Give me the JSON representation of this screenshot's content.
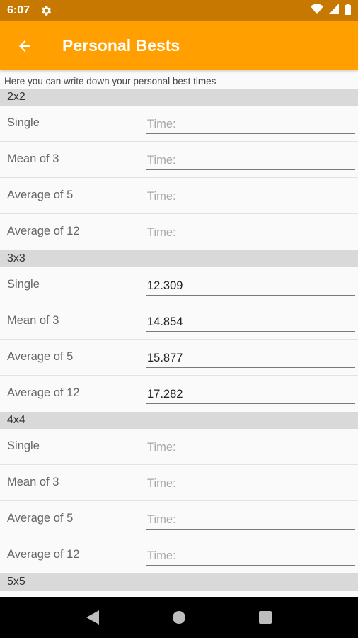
{
  "status_bar": {
    "time": "6:07"
  },
  "app_bar": {
    "title": "Personal Bests"
  },
  "hint": "Here you can write down your personal best times",
  "sections": [
    {
      "name": "2x2",
      "rows": [
        {
          "label": "Single",
          "value": "",
          "placeholder": "Time:"
        },
        {
          "label": "Mean of 3",
          "value": "",
          "placeholder": "Time:"
        },
        {
          "label": "Average of 5",
          "value": "",
          "placeholder": "Time:"
        },
        {
          "label": "Average of 12",
          "value": "",
          "placeholder": "Time:"
        }
      ]
    },
    {
      "name": "3x3",
      "rows": [
        {
          "label": "Single",
          "value": "12.309",
          "placeholder": "Time:"
        },
        {
          "label": "Mean of 3",
          "value": "14.854",
          "placeholder": "Time:"
        },
        {
          "label": "Average of 5",
          "value": "15.877",
          "placeholder": "Time:"
        },
        {
          "label": "Average of 12",
          "value": "17.282",
          "placeholder": "Time:"
        }
      ]
    },
    {
      "name": "4x4",
      "rows": [
        {
          "label": "Single",
          "value": "",
          "placeholder": "Time:"
        },
        {
          "label": "Mean of 3",
          "value": "",
          "placeholder": "Time:"
        },
        {
          "label": "Average of 5",
          "value": "",
          "placeholder": "Time:"
        },
        {
          "label": "Average of 12",
          "value": "",
          "placeholder": "Time:"
        }
      ]
    },
    {
      "name": "5x5",
      "rows": []
    }
  ],
  "colors": {
    "status_bar": "#c77800",
    "app_bar": "#ffa000",
    "section_header": "#d9d9d9"
  },
  "icons": {
    "back": "arrow-left-icon",
    "settings": "gear-icon",
    "wifi": "wifi-icon",
    "signal": "signal-icon",
    "battery": "battery-icon",
    "nav_back": "triangle-back-icon",
    "nav_home": "circle-home-icon",
    "nav_recents": "square-recents-icon"
  }
}
